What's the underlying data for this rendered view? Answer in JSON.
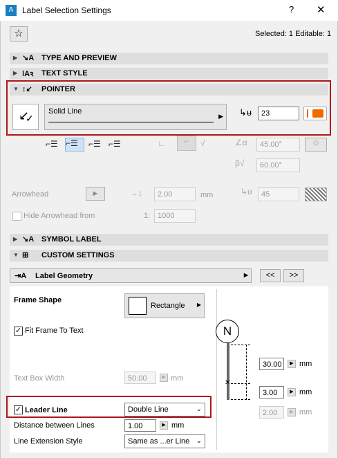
{
  "window": {
    "title": "Label Selection Settings",
    "help": "?",
    "close": "✕"
  },
  "header": {
    "selected_text": "Selected: 1 Editable: 1"
  },
  "sections": {
    "type_preview": "TYPE AND PREVIEW",
    "text_style": "TEXT STYLE",
    "pointer": "POINTER",
    "symbol_label": "SYMBOL LABEL",
    "custom_settings": "CUSTOM SETTINGS"
  },
  "pointer": {
    "line_type": "Solid Line",
    "pen_value": "23",
    "angle_alpha": "45.00°",
    "angle_beta": "60.00°",
    "arrowhead_label": "Arrowhead",
    "arrowhead_size": "2.00",
    "arrowhead_unit": "mm",
    "arrowhead_pen": "45",
    "hide_arrowhead_label": "Hide Arrowhead from",
    "scale_prefix": "1:",
    "scale_value": "1000"
  },
  "custom": {
    "label_geometry": "Label Geometry",
    "prev_btn": "<<",
    "next_btn": ">>",
    "frame_shape_label": "Frame Shape",
    "frame_shape_value": "Rectangle",
    "fit_frame_label": "Fit Frame To Text",
    "text_box_width_label": "Text Box Width",
    "text_box_width_value": "50.00",
    "text_box_width_unit": "mm",
    "leader_line_label": "Leader Line",
    "leader_line_value": "Double Line",
    "distance_label": "Distance between Lines",
    "distance_value": "1.00",
    "distance_unit": "mm",
    "ext_style_label": "Line Extension Style",
    "ext_style_value": "Same as ...er Line",
    "preview_marker": "N",
    "dim1_value": "30.00",
    "dim1_unit": "mm",
    "dim2_value": "3.00",
    "dim2_unit": "mm",
    "dim3_value": "2.00",
    "dim3_unit": "mm"
  },
  "colors": {
    "accent_red": "#b0151a",
    "pen_orange": "#f06a00"
  }
}
